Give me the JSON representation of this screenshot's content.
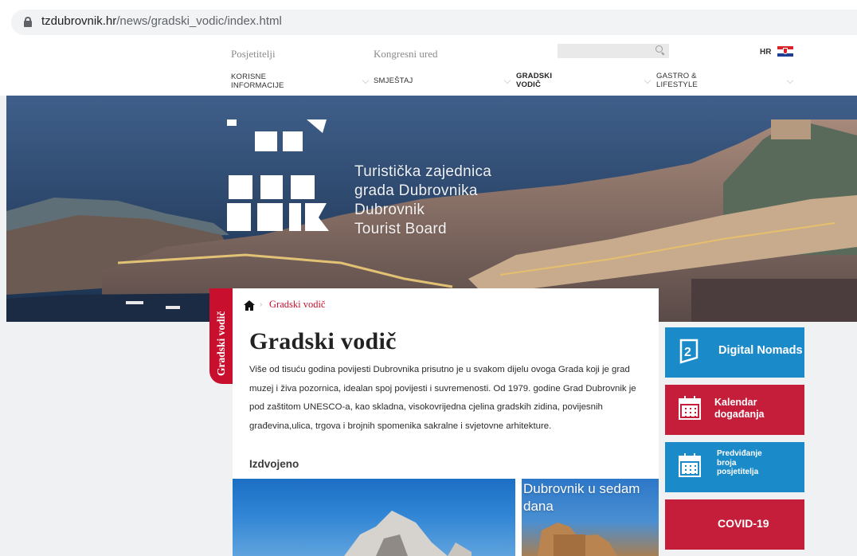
{
  "browser": {
    "url_host": "tzdubrovnik.hr",
    "url_path": "/news/gradski_vodic/index.html"
  },
  "header": {
    "top_links": [
      "Posjetitelji",
      "Kongresni ured"
    ],
    "language": "HR",
    "nav": [
      {
        "line1": "KORISNE",
        "line2": "INFORMACIJE",
        "active": false
      },
      {
        "line1": "SMJEŠTAJ",
        "line2": "",
        "active": false
      },
      {
        "line1": "GRADSKI",
        "line2": "VODIČ",
        "active": true
      },
      {
        "line1": "GASTRO &",
        "line2": "LIFESTYLE",
        "active": false
      }
    ]
  },
  "hero": {
    "logo_lines": [
      "DU",
      "BRO",
      "VNIK"
    ],
    "board_lines": [
      "Turistička zajednica",
      "grada Dubrovnika",
      "Dubrovnik",
      "Tourist Board"
    ]
  },
  "section_tab": "Gradski vodič",
  "breadcrumb": {
    "separator": "›",
    "current": "Gradski vodič"
  },
  "page": {
    "title": "Gradski vodič",
    "intro": "Više od tisuću godina povijesti Dubrovnika prisutno je u svakom dijelu ovoga Grada koji je grad muzej i živa pozornica, idealan spoj povijesti i suvremenosti. Od 1979. godine Grad Dubrovnik je pod zaštitom UNESCO-a, kao skladna, visokovrijedna cjelina gradskih zidina, povijesnih građevina,ulica, trgova i brojnih spomenika sakralne i svjetovne arhitekture.",
    "featured_heading": "Izdvojeno",
    "featured_small_caption_1": "Dubrovnik u sedam",
    "featured_small_caption_2": "dana"
  },
  "tiles": {
    "digital_nomads": "Digital Nomads",
    "kalendar_1": "Kalendar",
    "kalendar_2": "događanja",
    "predvidanje_1": "Predviđanje",
    "predvidanje_2": "broja",
    "predvidanje_3": "posjetitelja",
    "covid": "COVID-19"
  },
  "colors": {
    "brand_red": "#c8102e",
    "tile_blue": "#1b8ac8",
    "tile_red": "#c41e3a"
  }
}
